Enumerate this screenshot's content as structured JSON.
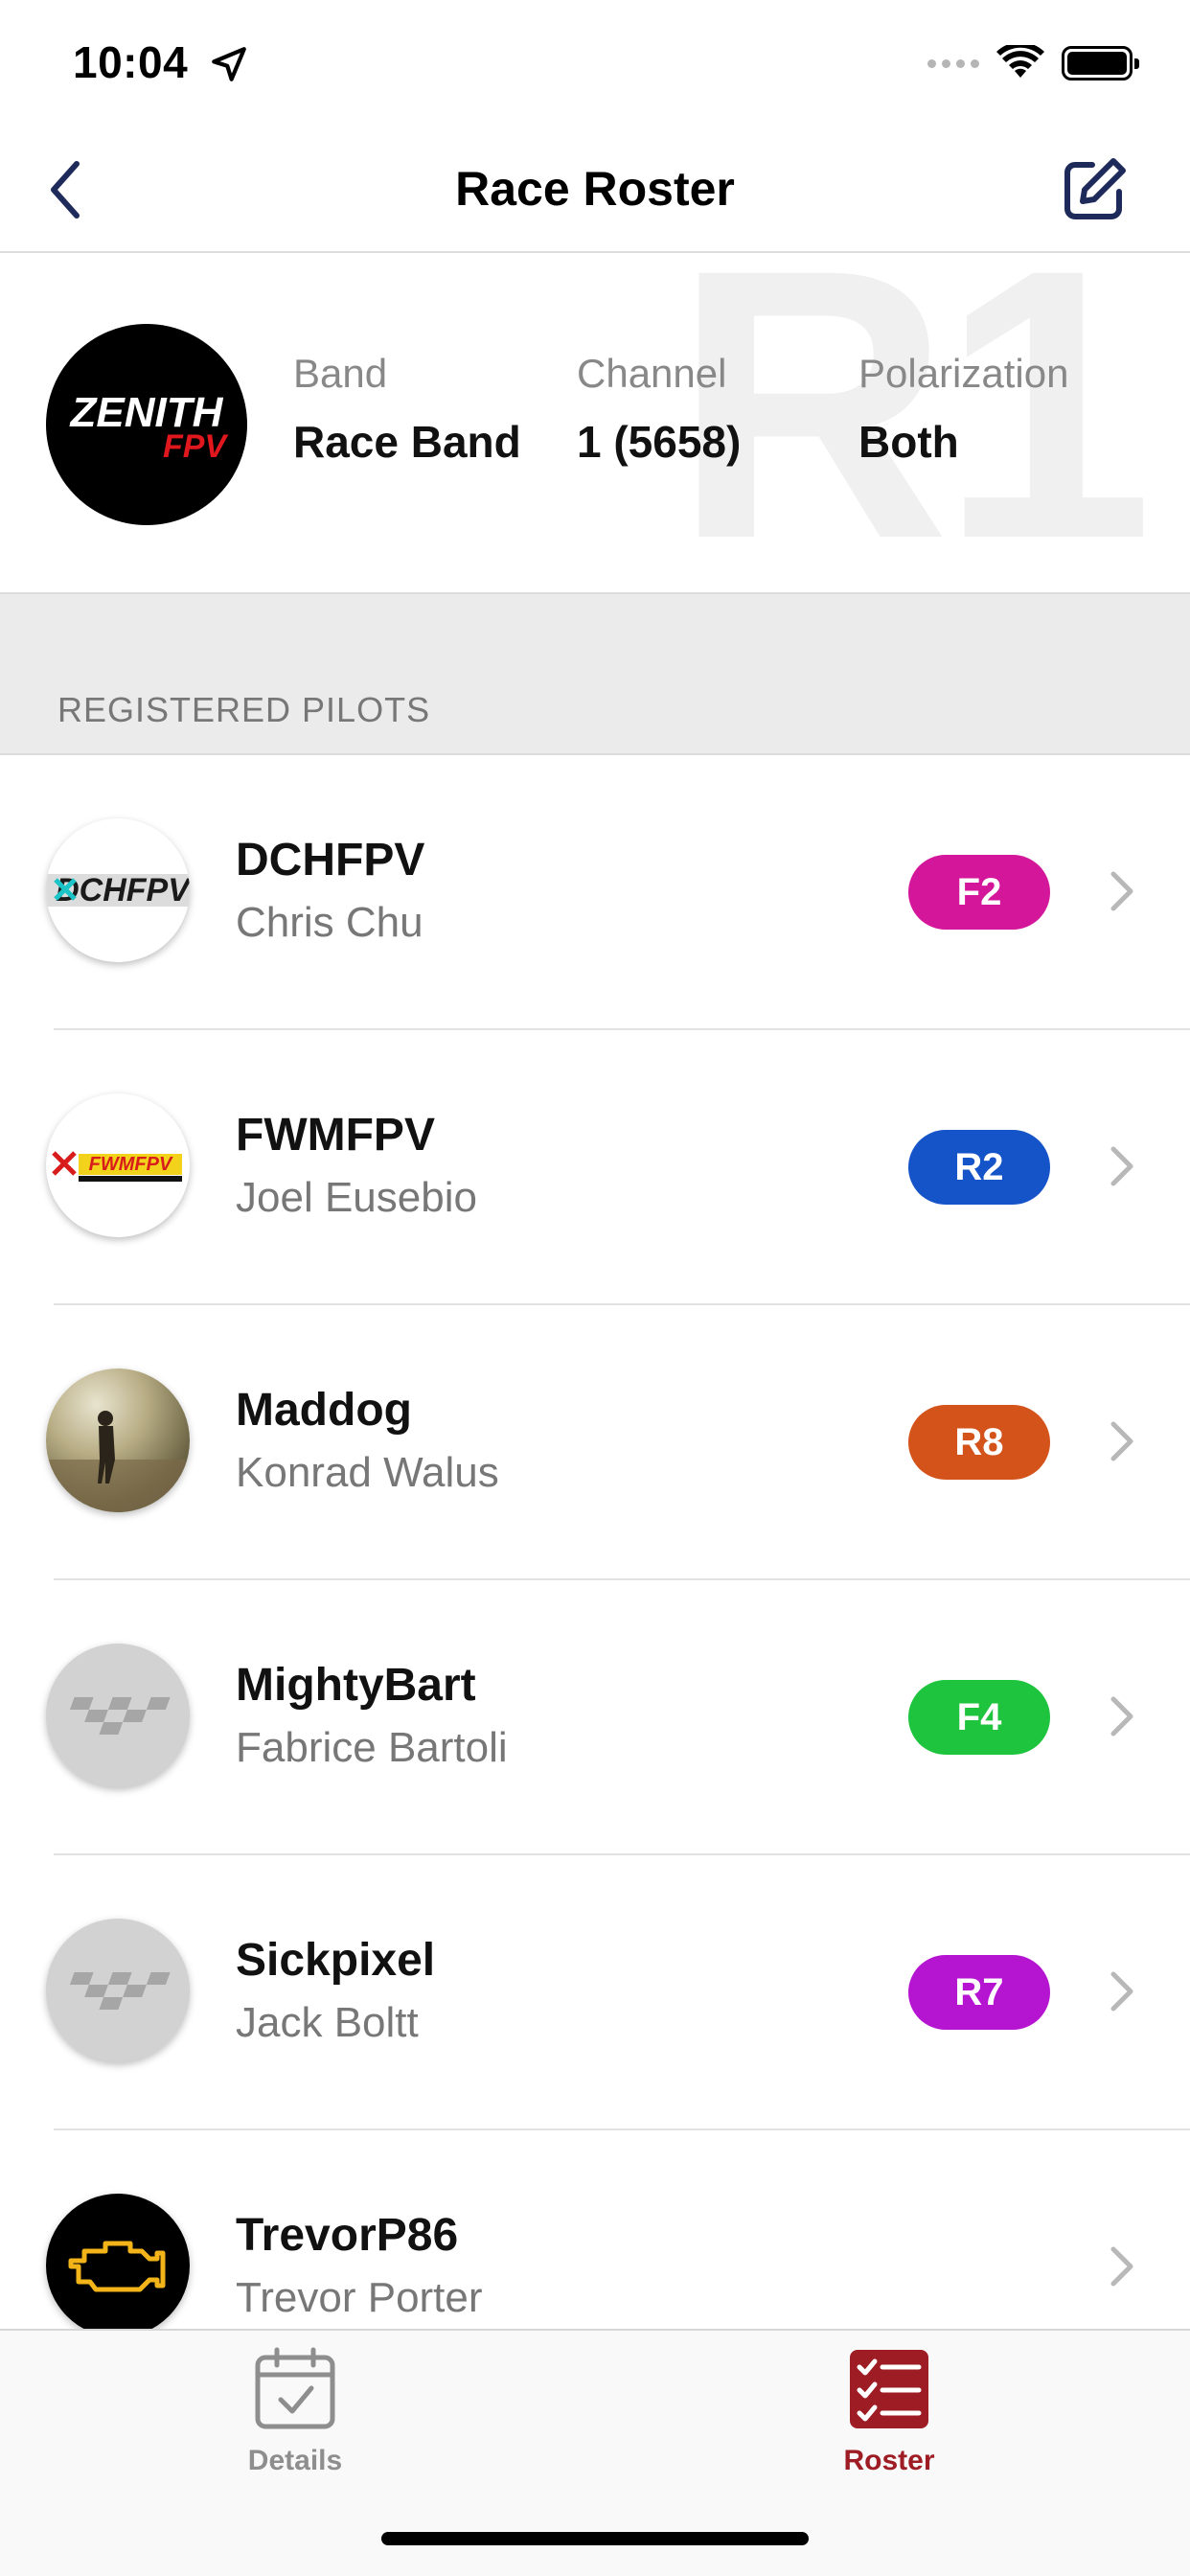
{
  "status_bar": {
    "time": "10:04"
  },
  "nav": {
    "title": "Race Roster"
  },
  "header": {
    "watermark": "R1",
    "columns": [
      {
        "label": "Band",
        "value": "Race Band"
      },
      {
        "label": "Channel",
        "value": "1 (5658)"
      },
      {
        "label": "Polarization",
        "value": "Both"
      }
    ]
  },
  "section": {
    "title": "REGISTERED PILOTS"
  },
  "pilots": [
    {
      "handle": "DCHFPV",
      "name": "Chris Chu",
      "channel": "F2",
      "color": "#d4179a"
    },
    {
      "handle": "FWMFPV",
      "name": "Joel Eusebio",
      "channel": "R2",
      "color": "#1553c9"
    },
    {
      "handle": "Maddog",
      "name": "Konrad Walus",
      "channel": "R8",
      "color": "#d4531a"
    },
    {
      "handle": "MightyBart",
      "name": "Fabrice Bartoli",
      "channel": "F4",
      "color": "#1fc43e"
    },
    {
      "handle": "Sickpixel",
      "name": "Jack Boltt",
      "channel": "R7",
      "color": "#b515d1"
    },
    {
      "handle": "TrevorP86",
      "name": "Trevor Porter",
      "channel": "",
      "color": ""
    }
  ],
  "tabs": [
    {
      "label": "Details",
      "icon": "calendar-check-icon",
      "active": false,
      "color": "#8e8e8e"
    },
    {
      "label": "Roster",
      "icon": "checklist-icon",
      "active": true,
      "color": "#9e1c24"
    }
  ],
  "colors": {
    "accent_nav": "#1e2b5a",
    "active_tab": "#9e1c24",
    "inactive_tab": "#8e8e8e"
  }
}
